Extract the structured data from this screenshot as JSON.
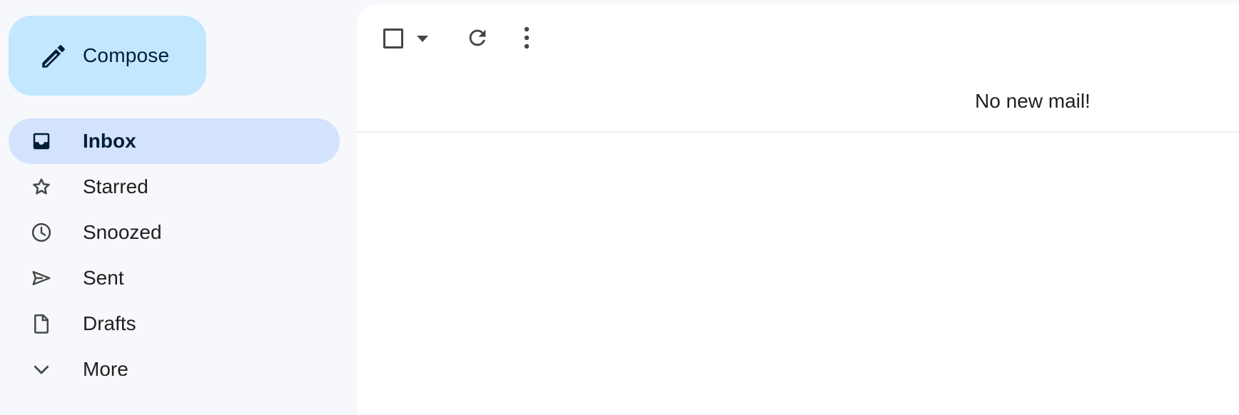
{
  "compose": {
    "label": "Compose",
    "icon": "pencil-icon"
  },
  "nav": {
    "items": [
      {
        "label": "Inbox",
        "icon": "inbox-icon",
        "active": true
      },
      {
        "label": "Starred",
        "icon": "star-icon"
      },
      {
        "label": "Snoozed",
        "icon": "clock-icon"
      },
      {
        "label": "Sent",
        "icon": "send-icon"
      },
      {
        "label": "Drafts",
        "icon": "draft-icon"
      },
      {
        "label": "More",
        "icon": "chevron-down-icon"
      }
    ]
  },
  "toolbar": {
    "select_icon": "checkbox-icon",
    "select_dropdown_icon": "caret-down-icon",
    "refresh_icon": "refresh-icon",
    "more_icon": "more-vert-icon"
  },
  "main": {
    "empty_message": "No new mail!"
  },
  "colors": {
    "background": "#f6f8fc",
    "compose_bg": "#c2e7ff",
    "active_nav_bg": "#d3e3fd",
    "icon": "#444746"
  }
}
